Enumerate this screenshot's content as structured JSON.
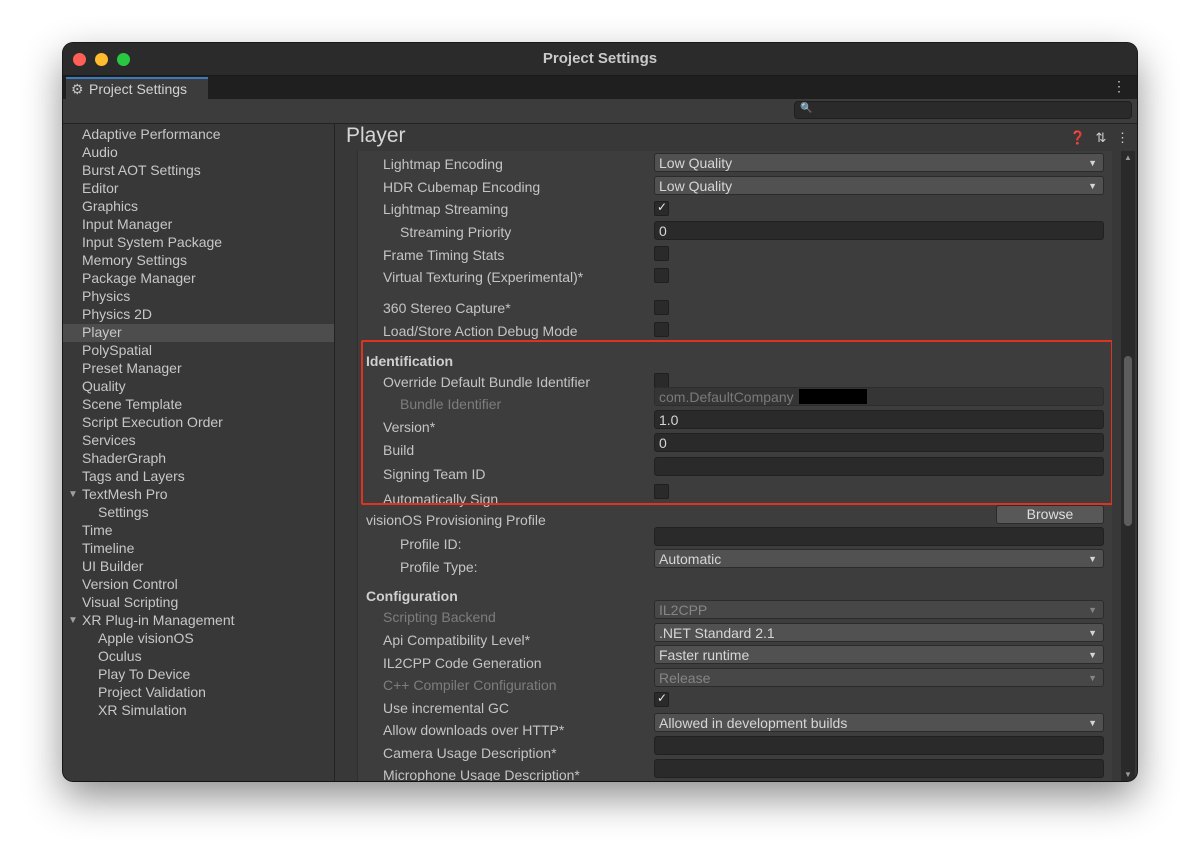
{
  "window": {
    "title": "Project Settings"
  },
  "tab": {
    "label": "Project Settings",
    "gear_glyph": "⚙",
    "menu_glyph": "⋮"
  },
  "search": {
    "glyph": "🔍",
    "placeholder": ""
  },
  "sidebar": {
    "items": [
      {
        "label": "Adaptive Performance"
      },
      {
        "label": "Audio"
      },
      {
        "label": "Burst AOT Settings"
      },
      {
        "label": "Editor"
      },
      {
        "label": "Graphics"
      },
      {
        "label": "Input Manager"
      },
      {
        "label": "Input System Package"
      },
      {
        "label": "Memory Settings"
      },
      {
        "label": "Package Manager"
      },
      {
        "label": "Physics"
      },
      {
        "label": "Physics 2D"
      },
      {
        "label": "Player"
      },
      {
        "label": "PolySpatial"
      },
      {
        "label": "Preset Manager"
      },
      {
        "label": "Quality"
      },
      {
        "label": "Scene Template"
      },
      {
        "label": "Script Execution Order"
      },
      {
        "label": "Services"
      },
      {
        "label": "ShaderGraph"
      },
      {
        "label": "Tags and Layers"
      },
      {
        "label": "TextMesh Pro"
      },
      {
        "label": "Settings"
      },
      {
        "label": "Time"
      },
      {
        "label": "Timeline"
      },
      {
        "label": "UI Builder"
      },
      {
        "label": "Version Control"
      },
      {
        "label": "Visual Scripting"
      },
      {
        "label": "XR Plug-in Management"
      },
      {
        "label": "Apple visionOS"
      },
      {
        "label": "Oculus"
      },
      {
        "label": "Play To Device"
      },
      {
        "label": "Project Validation"
      },
      {
        "label": "XR Simulation"
      }
    ],
    "selected": "Player",
    "fold_glyph": "▼"
  },
  "header": {
    "title": "Player",
    "icons": "❓ ⇅ ⋮"
  },
  "rows": {
    "lightmap_encoding": {
      "label": "Lightmap Encoding",
      "value": "Low Quality"
    },
    "hdr_cubemap_encoding": {
      "label": "HDR Cubemap Encoding",
      "value": "Low Quality"
    },
    "lightmap_streaming": {
      "label": "Lightmap Streaming",
      "checked": true
    },
    "streaming_priority": {
      "label": "Streaming Priority",
      "value": "0"
    },
    "frame_timing_stats": {
      "label": "Frame Timing Stats",
      "checked": false
    },
    "virtual_texturing": {
      "label": "Virtual Texturing (Experimental)*",
      "checked": false
    },
    "stereo_capture": {
      "label": "360 Stereo Capture*",
      "checked": false
    },
    "load_store_debug": {
      "label": "Load/Store Action Debug Mode",
      "checked": false
    }
  },
  "identification": {
    "header": "Identification",
    "override_bundle": {
      "label": "Override Default Bundle Identifier",
      "checked": false
    },
    "bundle_identifier": {
      "label": "Bundle Identifier",
      "value": "com.DefaultCompany"
    },
    "version": {
      "label": "Version*",
      "value": "1.0"
    },
    "build": {
      "label": "Build",
      "value": "0"
    },
    "signing_team": {
      "label": "Signing Team ID",
      "value": ""
    },
    "auto_sign": {
      "label": "Automatically Sign",
      "checked": false
    }
  },
  "provisioning": {
    "label": "visionOS Provisioning Profile",
    "browse": "Browse",
    "profile_id": {
      "label": "Profile ID:",
      "value": ""
    },
    "profile_type": {
      "label": "Profile Type:",
      "value": "Automatic"
    }
  },
  "configuration": {
    "header": "Configuration",
    "scripting_backend": {
      "label": "Scripting Backend",
      "value": "IL2CPP"
    },
    "api_level": {
      "label": "Api Compatibility Level*",
      "value": ".NET Standard 2.1"
    },
    "il2cpp_codegen": {
      "label": "IL2CPP Code Generation",
      "value": "Faster runtime"
    },
    "cpp_compiler": {
      "label": "C++ Compiler Configuration",
      "value": "Release"
    },
    "incremental_gc": {
      "label": "Use incremental GC",
      "checked": true
    },
    "http_downloads": {
      "label": "Allow downloads over HTTP*",
      "value": "Allowed in development builds"
    },
    "camera_usage": {
      "label": "Camera Usage Description*",
      "value": ""
    },
    "microphone_usage": {
      "label": "Microphone Usage Description*",
      "value": ""
    }
  },
  "glyphs": {
    "dropdown": "▼",
    "check": "✓",
    "scroll_up": "▲",
    "scroll_down": "▼"
  },
  "colors": {
    "highlight_box": "#e0331f",
    "selection": "#4d4d4d",
    "tab_accent": "#3a79bb"
  }
}
